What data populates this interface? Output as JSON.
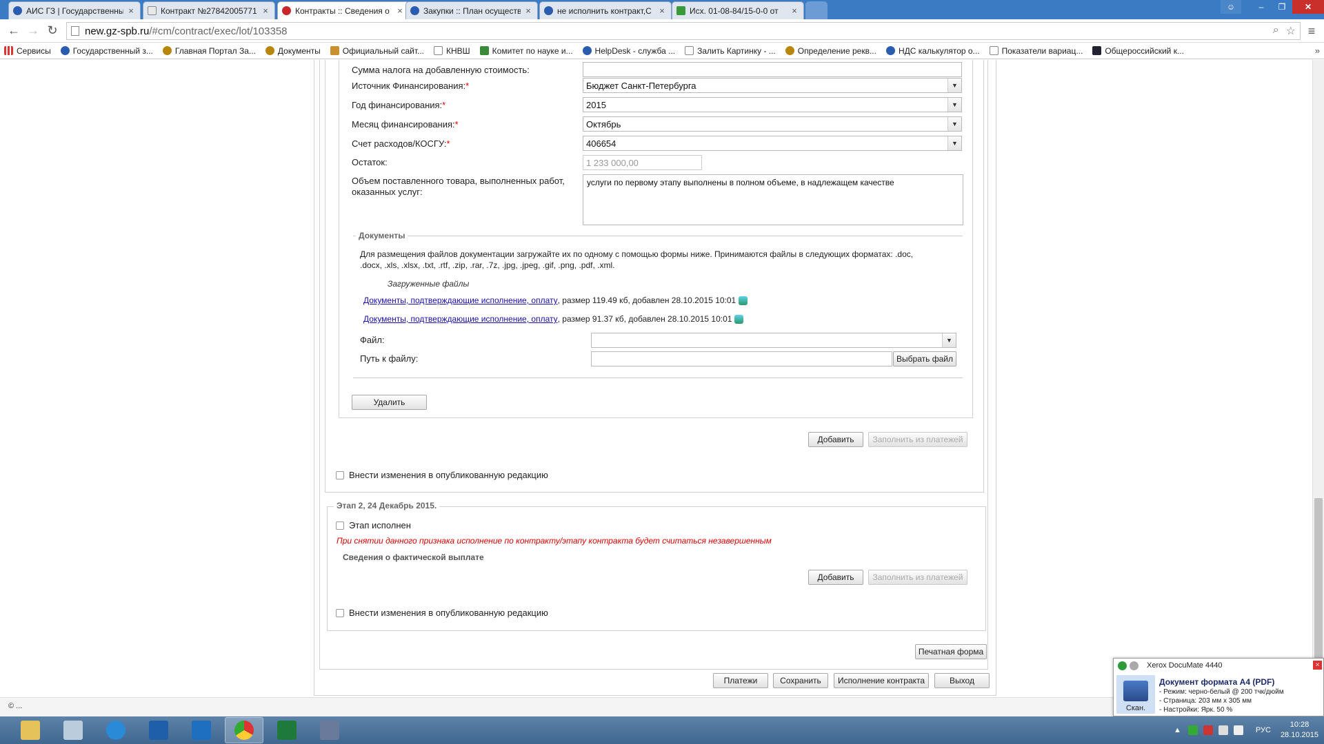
{
  "browser": {
    "tabs": [
      {
        "label": "АИС ГЗ | Государственны",
        "icon": "globe"
      },
      {
        "label": "Контракт №27842005771",
        "icon": "page"
      },
      {
        "label": "Контракты :: Сведения о",
        "icon": "red"
      },
      {
        "label": "Закупки :: План осуществ",
        "icon": "globe"
      },
      {
        "label": "не исполнить контракт,С",
        "icon": "globe"
      },
      {
        "label": "Исх. 01-08-84/15-0-0 от",
        "icon": "green"
      }
    ],
    "active_tab": 2,
    "url_host": "new.gz-spb.ru",
    "url_path": "/#cm/contract/exec/lot/103358",
    "bookmarks": [
      "Сервисы",
      "Государственный з...",
      "Главная Портал За...",
      "Документы",
      "Официальный сайт...",
      "КНВШ",
      "Комитет по науке и...",
      "HelpDesk - служба ...",
      "Залить Картинку - ...",
      "Определение рекв...",
      "НДС калькулятор о...",
      "Показатели вариац...",
      "Общероссийский к..."
    ]
  },
  "form": {
    "vat_label": "Сумма налога на добавленную стоимость:",
    "vat_value": "",
    "source_label": "Источник Финансирования:",
    "source_value": "Бюджет Санкт-Петербурга",
    "year_label": "Год финансирования:",
    "year_value": "2015",
    "month_label": "Месяц финансирования:",
    "month_value": "Октябрь",
    "account_label": "Счет расходов/КОСГУ:",
    "account_value": "406654",
    "remainder_label": "Остаток:",
    "remainder_value": "1 233 000,00",
    "volume_label_1": "Объем поставленного товара, выполненных работ,",
    "volume_label_2": "оказанных услуг:",
    "volume_value": "услуги по первому этапу выполнены в полном объеме, в надлежащем качестве",
    "required_mark": "*"
  },
  "documents": {
    "legend": "Документы",
    "help_line_1": "Для размещения файлов документации загружайте их по одному с помощью формы ниже. Принимаются файлы в следующих форматах: .doc,",
    "help_line_2": ".docx, .xls, .xlsx, .txt, .rtf, .zip, .rar, .7z, .jpg, .jpeg, .gif, .png, .pdf, .xml.",
    "uploaded_title": "Загруженные файлы",
    "files": [
      {
        "link": "Документы, подтверждающие исполнение, оплату",
        "meta": ", размер 119.49 кб, добавлен 28.10.2015 10:01"
      },
      {
        "link": "Документы, подтверждающие исполнение, оплату",
        "meta": ", размер 91.37 кб, добавлен 28.10.2015 10:01"
      }
    ],
    "file_label": "Файл:",
    "file_value": "",
    "path_label": "Путь к файлу:",
    "path_value": "",
    "choose_file": "Выбрать файл"
  },
  "buttons": {
    "delete": "Удалить",
    "add": "Добавить",
    "fill_from_payments": "Заполнить из платежей",
    "print_form": "Печатная форма",
    "payments": "Платежи",
    "save": "Сохранить",
    "contract_execution": "Исполнение контракта",
    "exit": "Выход"
  },
  "stage1": {
    "publish_changes": "Внести изменения в опубликованную редакцию"
  },
  "stage2": {
    "legend": "Этап 2, 24 Декабрь 2015.",
    "completed_label": "Этап исполнен",
    "warning": "При снятии данного признака исполнение по контракту/этапу контракта будет считаться незавершенным",
    "payment_heading": "Сведения о фактической выплате",
    "publish_changes": "Внести изменения в опубликованную редакцию"
  },
  "footer": {
    "copyright": "© ..."
  },
  "notification": {
    "app_name": "Xerox DocuMate 4440",
    "title": "Документ формата А4 (PDF)",
    "lines": [
      "- Режим: черно-белый @ 200 тчк/дюйм",
      "- Страница: 203 мм x 305 мм",
      "- Настройки: Ярк. 50 %"
    ],
    "scan_label": "Скан."
  },
  "taskbar": {
    "apps": [
      "explorer",
      "calculator",
      "internet-explorer",
      "lync",
      "outlook",
      "chrome",
      "excel",
      "app"
    ],
    "active": "chrome",
    "lang": "РУС",
    "time": "10:28",
    "date": "28.10.2015"
  }
}
